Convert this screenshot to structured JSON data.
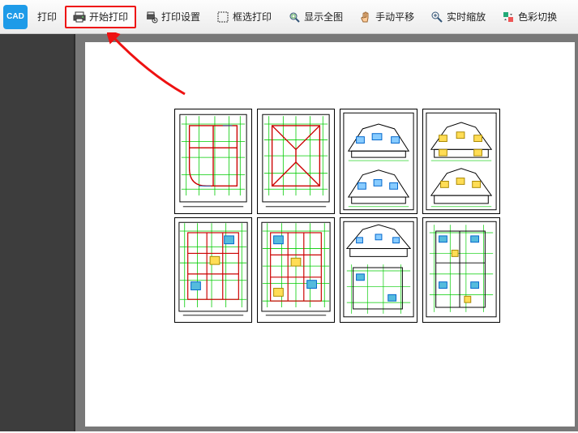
{
  "app": {
    "logo_text": "CAD",
    "tab_label": "打印"
  },
  "toolbar": {
    "start_print": "开始打印",
    "print_settings": "打印设置",
    "box_select_print": "框选打印",
    "show_full": "显示全图",
    "manual_pan": "手动平移",
    "realtime_zoom": "实时缩放",
    "color_switch": "色彩切换"
  },
  "annotation": {
    "arrow_color": "#e11",
    "highlight_target": "start_print"
  },
  "preview": {
    "sheet_bg": "#ffffff",
    "gutter_bg": "#3d3d3d",
    "drawing_count": 8
  }
}
